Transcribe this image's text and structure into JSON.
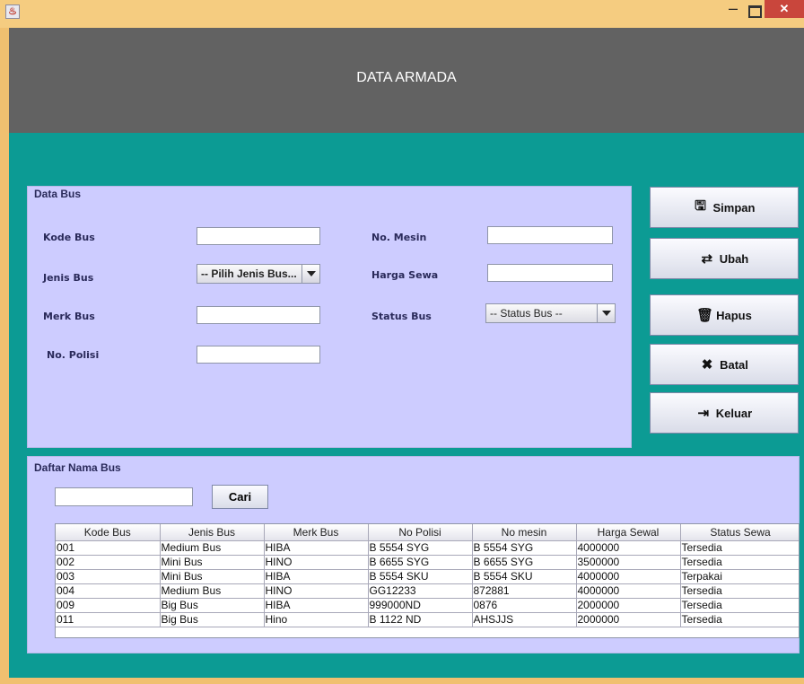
{
  "window": {
    "icon": "java-cup-icon",
    "minimize_glyph": "–",
    "close_glyph": "✕"
  },
  "header": {
    "title": "DATA ARMADA"
  },
  "data_bus": {
    "legend": "Data Bus",
    "kode_bus": {
      "label": "Kode Bus",
      "value": ""
    },
    "jenis_bus": {
      "label": "Jenis Bus",
      "selected": "-- Pilih Jenis Bus..."
    },
    "merk_bus": {
      "label": "Merk Bus",
      "value": ""
    },
    "no_polisi": {
      "label": "No. Polisi",
      "value": ""
    },
    "no_mesin": {
      "label": "No. Mesin",
      "value": ""
    },
    "harga_sewa": {
      "label": "Harga Sewa",
      "value": ""
    },
    "status_bus": {
      "label": "Status Bus",
      "selected": "-- Status Bus --"
    }
  },
  "actions": {
    "simpan": {
      "label": "Simpan",
      "icon": "save-icon"
    },
    "ubah": {
      "label": "Ubah",
      "icon": "refresh-icon"
    },
    "hapus": {
      "label": "Hapus",
      "icon": "trash-icon"
    },
    "batal": {
      "label": "Batal",
      "icon": "cancel-icon"
    },
    "keluar": {
      "label": "Keluar",
      "icon": "sign-out-icon"
    }
  },
  "daftar": {
    "legend": "Daftar Nama Bus",
    "search_value": "",
    "search_button": "Cari",
    "columns": [
      "Kode Bus",
      "Jenis Bus",
      "Merk Bus",
      "No Polisi",
      "No mesin",
      "Harga Sewal",
      "Status Sewa"
    ],
    "rows": [
      [
        "001",
        "Medium Bus",
        "HIBA",
        "B 5554 SYG",
        "B 5554 SYG",
        "4000000",
        "Tersedia"
      ],
      [
        "002",
        "Mini Bus",
        "HINO",
        "B 6655 SYG",
        "B 6655 SYG",
        "3500000",
        "Tersedia"
      ],
      [
        "003",
        "Mini Bus",
        "HIBA",
        "B 5554 SKU",
        "B 5554 SKU",
        "4000000",
        "Terpakai"
      ],
      [
        "004",
        "Medium Bus",
        "HINO",
        "GG12233",
        "872881",
        "4000000",
        "Tersedia"
      ],
      [
        "009",
        "Big Bus",
        "HIBA",
        "999000ND",
        "0876",
        "2000000",
        "Tersedia"
      ],
      [
        "011",
        "Big Bus",
        "Hino",
        "B 1122 ND",
        "AHSJJS",
        "2000000",
        "Tersedia"
      ]
    ]
  }
}
